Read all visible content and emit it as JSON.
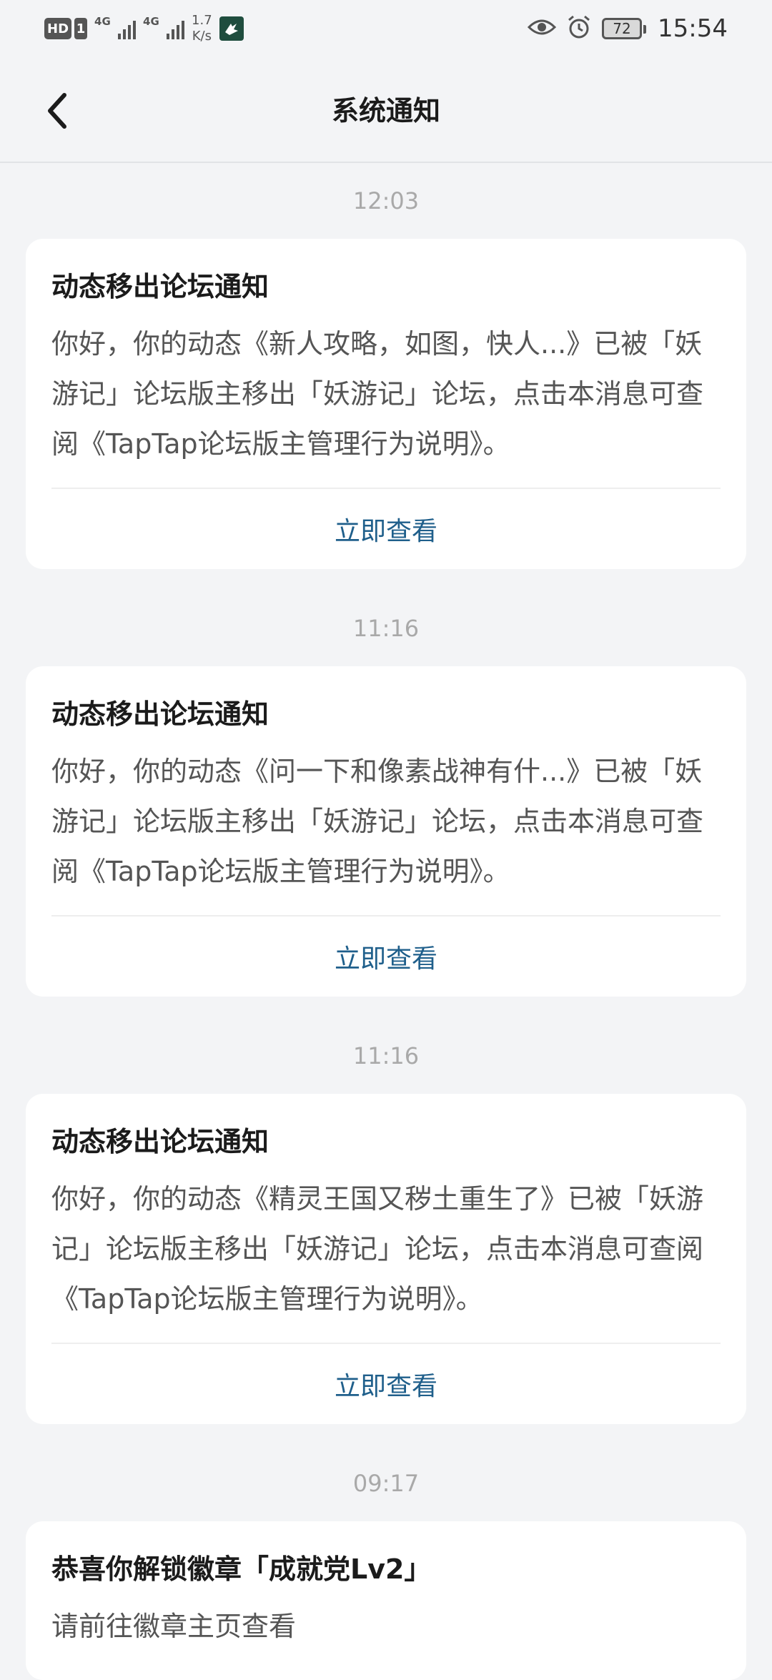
{
  "status_bar": {
    "hd": "HD",
    "sim": "1",
    "signal1_net": "4G",
    "signal2_net": "4G",
    "speed_value": "1.7",
    "speed_unit": "K/s",
    "battery": "72",
    "time": "15:54"
  },
  "header": {
    "title": "系统通知"
  },
  "messages": [
    {
      "time": "12:03",
      "title": "动态移出论坛通知",
      "body": "你好，你的动态《新人攻略，如图，快人...》已被「妖游记」论坛版主移出「妖游记」论坛，点击本消息可查阅《TapTap论坛版主管理行为说明》。",
      "action": "立即查看"
    },
    {
      "time": "11:16",
      "title": "动态移出论坛通知",
      "body": "你好，你的动态《问一下和像素战神有什...》已被「妖游记」论坛版主移出「妖游记」论坛，点击本消息可查阅《TapTap论坛版主管理行为说明》。",
      "action": "立即查看"
    },
    {
      "time": "11:16",
      "title": "动态移出论坛通知",
      "body": "你好，你的动态《精灵王国又秽土重生了》已被「妖游记」论坛版主移出「妖游记」论坛，点击本消息可查阅《TapTap论坛版主管理行为说明》。",
      "action": "立即查看"
    },
    {
      "time": "09:17",
      "title": "恭喜你解锁徽章「成就党Lv2」",
      "body": "请前往徽章主页查看"
    }
  ],
  "colors": {
    "background": "#f3f4f6",
    "card": "#ffffff",
    "link": "#1f5f8b",
    "time": "#a9a9a9"
  },
  "icons": {
    "back": "chevron-left-icon",
    "eye": "eye-icon",
    "alarm": "alarm-icon",
    "app": "app-notification-icon"
  }
}
